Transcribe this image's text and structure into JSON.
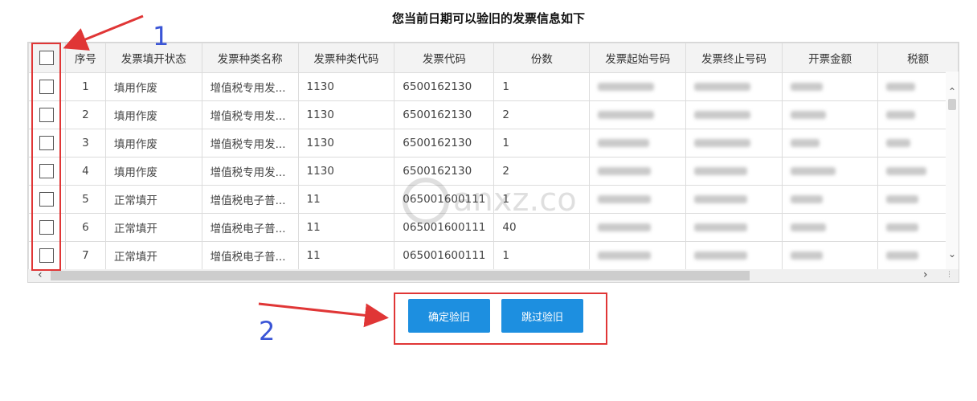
{
  "title": "您当前日期可以验旧的发票信息如下",
  "columns": [
    "序号",
    "发票填开状态",
    "发票种类名称",
    "发票种类代码",
    "发票代码",
    "份数",
    "发票起始号码",
    "发票终止号码",
    "开票金额",
    "税额"
  ],
  "rows": [
    {
      "idx": "1",
      "status": "填用作废",
      "type_name": "增值税专用发...",
      "type_code": "1130",
      "code": "6500162130",
      "count": "1"
    },
    {
      "idx": "2",
      "status": "填用作废",
      "type_name": "增值税专用发...",
      "type_code": "1130",
      "code": "6500162130",
      "count": "2"
    },
    {
      "idx": "3",
      "status": "填用作废",
      "type_name": "增值税专用发...",
      "type_code": "1130",
      "code": "6500162130",
      "count": "1"
    },
    {
      "idx": "4",
      "status": "填用作废",
      "type_name": "增值税专用发...",
      "type_code": "1130",
      "code": "6500162130",
      "count": "2"
    },
    {
      "idx": "5",
      "status": "正常填开",
      "type_name": "增值税电子普...",
      "type_code": "11",
      "code": "065001600111",
      "count": "1"
    },
    {
      "idx": "6",
      "status": "正常填开",
      "type_name": "增值税电子普...",
      "type_code": "11",
      "code": "065001600111",
      "count": "40"
    },
    {
      "idx": "7",
      "status": "正常填开",
      "type_name": "增值税电子普...",
      "type_code": "11",
      "code": "065001600111",
      "count": "1"
    }
  ],
  "buttons": {
    "confirm": "确定验旧",
    "skip": "跳过验旧"
  },
  "annotations": {
    "n1": "1",
    "n2": "2"
  },
  "colors": {
    "accent": "#1d8fe0",
    "highlight": "#e03636",
    "annotation_number": "#3a55d6"
  },
  "icons": {
    "scroll_up": "chevron-up-icon",
    "scroll_down": "chevron-down-icon",
    "scroll_left": "chevron-left-icon",
    "scroll_right": "chevron-right-icon"
  }
}
